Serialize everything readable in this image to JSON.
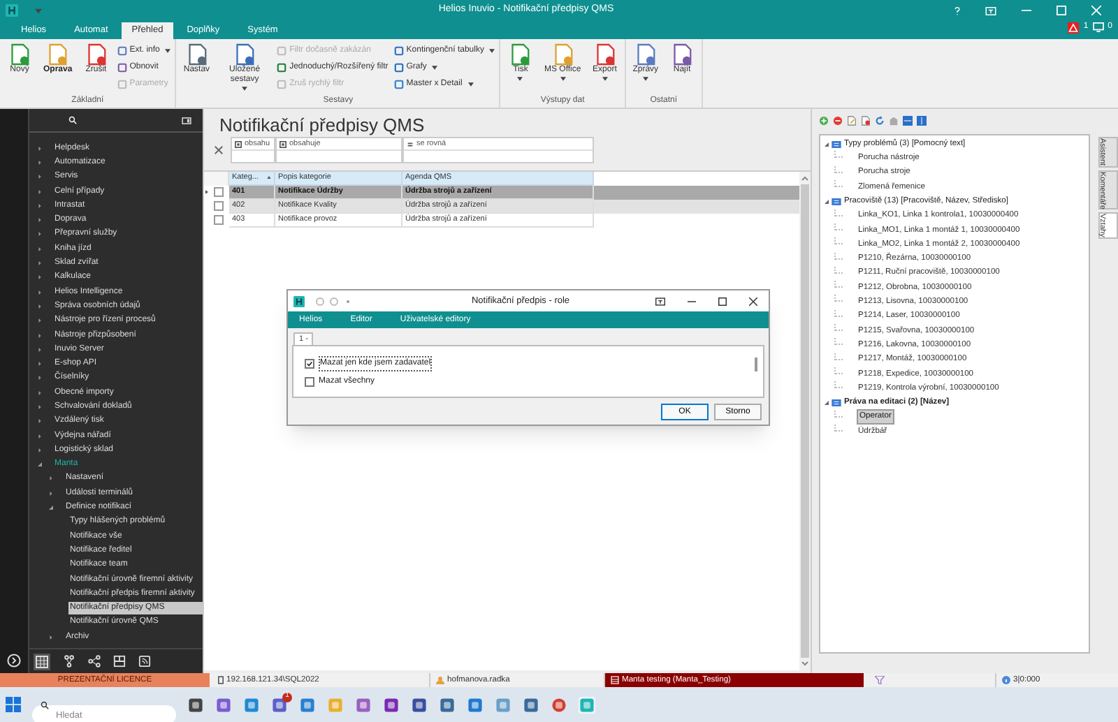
{
  "window": {
    "title": "Helios Inuvio - Notifikační předpisy QMS",
    "alerts": "1",
    "messages": "0"
  },
  "ribbon_tabs": [
    {
      "label": "Helios",
      "selected": false
    },
    {
      "label": "Automat",
      "selected": false
    },
    {
      "label": "Přehled",
      "selected": true
    },
    {
      "label": "Doplňky",
      "selected": false
    },
    {
      "label": "Systém",
      "selected": false
    }
  ],
  "ribbon_groups": [
    {
      "label": "Základní",
      "columns": [
        [
          {
            "kind": "large",
            "label": "Nový",
            "bold": false
          }
        ],
        [
          {
            "kind": "large",
            "label": "Oprava",
            "bold": true
          }
        ],
        [
          {
            "kind": "large",
            "label": "Zrušit",
            "bold": false
          }
        ],
        [
          {
            "kind": "small",
            "label": "Ext. info",
            "disabled": false,
            "dropdown": true
          },
          {
            "kind": "small",
            "label": "Obnovit",
            "disabled": false,
            "dropdown": false
          },
          {
            "kind": "small",
            "label": "Parametry",
            "disabled": true,
            "dropdown": false
          }
        ]
      ]
    },
    {
      "label": "Sestavy",
      "columns": [
        [
          {
            "kind": "large",
            "label": "Nastav",
            "bold": false,
            "dropdown": false
          }
        ],
        [
          {
            "kind": "large",
            "label": "Uložené sestavy",
            "bold": false,
            "dropdown": true
          }
        ],
        [
          {
            "kind": "small",
            "label": "Filtr dočasně zakázán",
            "disabled": true,
            "dropdown": false
          },
          {
            "kind": "small",
            "label": "Jednoduchý/Rozšířený filtr",
            "disabled": false,
            "dropdown": false
          },
          {
            "kind": "small",
            "label": "Zruš rychlý filtr",
            "disabled": true,
            "dropdown": false
          }
        ],
        [
          {
            "kind": "small",
            "label": "Kontingenční tabulky",
            "disabled": false,
            "dropdown": true
          },
          {
            "kind": "small",
            "label": "Grafy",
            "disabled": false,
            "dropdown": true
          },
          {
            "kind": "small",
            "label": "Master x Detail",
            "disabled": false,
            "dropdown": true
          }
        ]
      ]
    },
    {
      "label": "Výstupy dat",
      "columns": [
        [
          {
            "kind": "large",
            "label": "Tisk",
            "dropdown": true
          }
        ],
        [
          {
            "kind": "large",
            "label": "MS Office",
            "dropdown": true
          }
        ],
        [
          {
            "kind": "large",
            "label": "Export",
            "dropdown": true
          }
        ]
      ]
    },
    {
      "label": "Ostatní",
      "columns": [
        [
          {
            "kind": "large",
            "label": "Zprávy",
            "dropdown": true
          }
        ],
        [
          {
            "kind": "large",
            "label": "Najít",
            "dropdown": false
          }
        ]
      ]
    }
  ],
  "sidebar": {
    "items": [
      {
        "label": "Helpdesk",
        "expanded": false,
        "selected": false
      },
      {
        "label": "Automatizace",
        "expanded": false,
        "selected": false
      },
      {
        "label": "Servis",
        "expanded": false,
        "selected": false
      },
      {
        "label": "Celní případy",
        "expanded": false,
        "selected": false
      },
      {
        "label": "Intrastat",
        "expanded": false,
        "selected": false
      },
      {
        "label": "Doprava",
        "expanded": false,
        "selected": false
      },
      {
        "label": "Přepravní služby",
        "expanded": false,
        "selected": false
      },
      {
        "label": "Kniha jízd",
        "expanded": false,
        "selected": false
      },
      {
        "label": "Sklad zvířat",
        "expanded": false,
        "selected": false
      },
      {
        "label": "Kalkulace",
        "expanded": false,
        "selected": false
      },
      {
        "label": "Helios Intelligence",
        "expanded": false,
        "selected": false
      },
      {
        "label": "Správa osobních údajů",
        "expanded": false,
        "selected": false
      },
      {
        "label": "Nástroje pro řízení procesů",
        "expanded": false,
        "selected": false
      },
      {
        "label": "Nástroje přizpůsobení",
        "expanded": false,
        "selected": false
      },
      {
        "label": "Inuvio Server",
        "expanded": false,
        "selected": false
      },
      {
        "label": "E-shop API",
        "expanded": false,
        "selected": false
      },
      {
        "label": "Číselníky",
        "expanded": false,
        "selected": false
      },
      {
        "label": "Obecné importy",
        "expanded": false,
        "selected": false
      },
      {
        "label": "Schvalování dokladů",
        "expanded": false,
        "selected": false
      },
      {
        "label": "Vzdálený tisk",
        "expanded": false,
        "selected": false
      },
      {
        "label": "Výdejna nářadí",
        "expanded": false,
        "selected": false
      },
      {
        "label": "Logistický sklad",
        "expanded": false,
        "selected": false
      },
      {
        "label": "Manta",
        "expanded": true,
        "selected": false,
        "children": [
          {
            "label": "Nastavení",
            "expanded": false,
            "selected": false
          },
          {
            "label": "Události terminálů",
            "expanded": false,
            "selected": false
          },
          {
            "label": "Definice notifikací",
            "expanded": true,
            "selected": false,
            "children": [
              {
                "label": "Typy hlášených problémů",
                "selected": false
              },
              {
                "label": "Notifikace vše",
                "selected": false
              },
              {
                "label": "Notifikace ředitel",
                "selected": false
              },
              {
                "label": "Notifikace team",
                "selected": false
              },
              {
                "label": "Notifikační úrovně firemní aktivity",
                "selected": false
              },
              {
                "label": "Notifikační předpis firemní aktivity",
                "selected": false
              },
              {
                "label": "Notifikační předpisy QMS",
                "selected": true
              },
              {
                "label": "Notifikační úrovně QMS",
                "selected": false
              }
            ]
          },
          {
            "label": "Archiv",
            "expanded": false,
            "selected": false
          }
        ]
      }
    ]
  },
  "page_title": "Notifikační předpisy QMS",
  "filters": [
    "obsahu",
    "obsahuje",
    "se rovná"
  ],
  "table": {
    "columns": [
      "Kateg...",
      "Popis kategorie",
      "Agenda QMS"
    ],
    "rows": [
      {
        "cells": [
          "401",
          "Notifikace Údržby",
          "Údržba strojů a zařízení"
        ],
        "selected": true,
        "checked": false
      },
      {
        "cells": [
          "402",
          "Notifikace Kvality",
          "Údržba strojů a zařízení"
        ],
        "selected": false,
        "checked": false
      },
      {
        "cells": [
          "403",
          "Notifikace provoz",
          "Údržba strojů a zařízení"
        ],
        "selected": false,
        "checked": false
      }
    ]
  },
  "relations": {
    "groups": [
      {
        "label": "Typy problémů (3) [Pomocný text]",
        "bold": false,
        "expanded": true,
        "items": [
          {
            "label": "Porucha nástroje",
            "selected": false
          },
          {
            "label": "Porucha stroje",
            "selected": false
          },
          {
            "label": "Zlomená řemenice",
            "selected": false
          }
        ]
      },
      {
        "label": "Pracoviště (13) [Pracoviště, Název, Středisko]",
        "bold": false,
        "expanded": true,
        "items": [
          {
            "label": "Linka_KO1, Linka 1 kontrola1, 10030000400",
            "selected": false
          },
          {
            "label": "Linka_MO1, Linka 1 montáž 1, 10030000400",
            "selected": false
          },
          {
            "label": "Linka_MO2, Linka 1 montáž 2, 10030000400",
            "selected": false
          },
          {
            "label": "P1210, Řezárna, 10030000100",
            "selected": false
          },
          {
            "label": "P1211, Ruční pracoviště, 10030000100",
            "selected": false
          },
          {
            "label": "P1212, Obrobna, 10030000100",
            "selected": false
          },
          {
            "label": "P1213, Lisovna, 10030000100",
            "selected": false
          },
          {
            "label": "P1214, Laser, 10030000100",
            "selected": false
          },
          {
            "label": "P1215, Svařovna, 10030000100",
            "selected": false
          },
          {
            "label": "P1216, Lakovna, 10030000100",
            "selected": false
          },
          {
            "label": "P1217, Montáž, 10030000100",
            "selected": false
          },
          {
            "label": "P1218, Expedice, 10030000100",
            "selected": false
          },
          {
            "label": "P1219, Kontrola výrobní, 10030000100",
            "selected": false
          }
        ]
      },
      {
        "label": "Práva na editaci (2) [Název]",
        "bold": true,
        "expanded": true,
        "items": [
          {
            "label": "Operator",
            "selected": true
          },
          {
            "label": "Údržbář",
            "selected": false
          }
        ]
      }
    ]
  },
  "side_tabs": [
    {
      "label": "Asistent",
      "selected": false
    },
    {
      "label": "Komentáře",
      "selected": false
    },
    {
      "label": "Vztahy",
      "selected": true
    }
  ],
  "dialog": {
    "title": "Notifikační předpis - role",
    "menu": [
      "Helios",
      "Editor",
      "Uživatelské editory"
    ],
    "tab": "1 -",
    "options": [
      {
        "label": "Mazat jen kde jsem zadavatel",
        "checked": true
      },
      {
        "label": "Mazat všechny",
        "checked": false
      }
    ],
    "buttons": [
      "OK",
      "Storno"
    ]
  },
  "status_bar": {
    "license": "PREZENTAČNÍ LICENCE",
    "server": "192.168.121.34\\SQL2022",
    "user": "hofmanova.radka",
    "database": "Manta testing (Manta_Testing)",
    "counter": "3|0:000"
  },
  "taskbar": {
    "search_placeholder": "Hledat",
    "badge": "1"
  }
}
